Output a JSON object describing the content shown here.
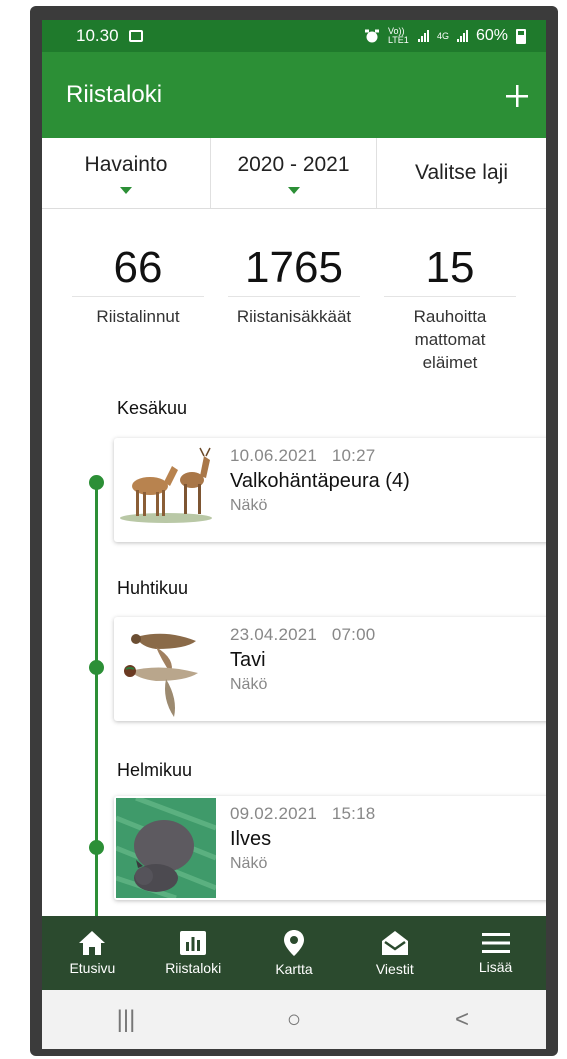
{
  "status_bar": {
    "time": "10.30",
    "network_small": "Vo)) LTE1",
    "gen": "4G",
    "battery": "60%"
  },
  "app_bar": {
    "title": "Riistaloki",
    "add_icon": "plus-icon"
  },
  "filters": [
    {
      "label": "Havainto",
      "has_dropdown": true
    },
    {
      "label": "2020 - 2021",
      "has_dropdown": true
    },
    {
      "label": "Valitse laji",
      "has_dropdown": false
    }
  ],
  "stats": [
    {
      "value": "66",
      "label": "Riistalinnut"
    },
    {
      "value": "1765",
      "label": "Riistanisäkkäät"
    },
    {
      "value": "15",
      "label": "Rauhoitta mattomat eläimet"
    }
  ],
  "entries": [
    {
      "month": "Kesäkuu",
      "date": "10.06.2021",
      "time": "10:27",
      "species": "Valkohäntäpeura (4)",
      "type": "Näkö",
      "image": "deer-image"
    },
    {
      "month": "Huhtikuu",
      "date": "23.04.2021",
      "time": "07:00",
      "species": "Tavi",
      "type": "Näkö",
      "image": "teal-duck-image"
    },
    {
      "month": "Helmikuu",
      "date": "09.02.2021",
      "time": "15:18",
      "species": "Ilves",
      "type": "Näkö",
      "image": "lynx-photo"
    }
  ],
  "nav": [
    {
      "label": "Etusivu",
      "icon": "home-icon"
    },
    {
      "label": "Riistaloki",
      "icon": "bar-chart-icon"
    },
    {
      "label": "Kartta",
      "icon": "map-pin-icon"
    },
    {
      "label": "Viestit",
      "icon": "envelope-open-icon"
    },
    {
      "label": "Lisää",
      "icon": "menu-icon"
    }
  ],
  "system_nav": {
    "recents": "|||",
    "home": "○",
    "back": "<"
  },
  "colors": {
    "status_bar": "#1f7a2c",
    "primary": "#2c8f36",
    "bottom_nav": "#2b4a2e"
  }
}
